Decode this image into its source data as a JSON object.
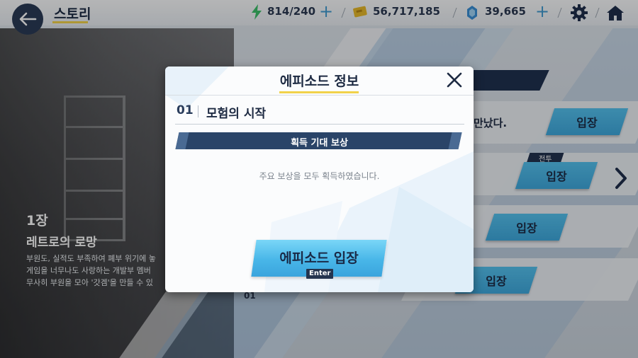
{
  "header": {
    "title": "스토리",
    "stamina": "814/240",
    "credits": "56,717,185",
    "gems": "39,665"
  },
  "chapter": {
    "number": "1장",
    "name": "레트로의 로망",
    "desc_lines": [
      "부원도, 실적도 부족하여 폐부 위기에 놓",
      "게임을 너무나도 사랑하는 개발부 멤버",
      "무사히 부원을 모아 '갓겜'을 만들 수 있"
    ]
  },
  "episode_list": {
    "row_text": "만났다.",
    "enter_label": "입장",
    "battle_tag": "전투",
    "partial_number": "01"
  },
  "modal": {
    "title": "에피소드 정보",
    "episode_number": "01",
    "episode_title": "모험의 시작",
    "reward_header": "획득 기대 보상",
    "reward_message": "주요 보상을 모두 획득하였습니다.",
    "enter_button": "에피소드 입장",
    "key_hint": "Enter"
  },
  "icons": {
    "back": "arrow-left-icon",
    "stamina": "lightning-icon",
    "credits": "credit-ticket-icon",
    "gems": "gem-icon",
    "settings": "gear-icon",
    "home": "home-icon",
    "close": "close-icon",
    "next": "chevron-right-icon"
  },
  "colors": {
    "navy": "#1f3150",
    "accent_blue": "#48b6e8",
    "highlight_yellow": "#f1d24a",
    "stamina_green": "#3cc06a"
  }
}
